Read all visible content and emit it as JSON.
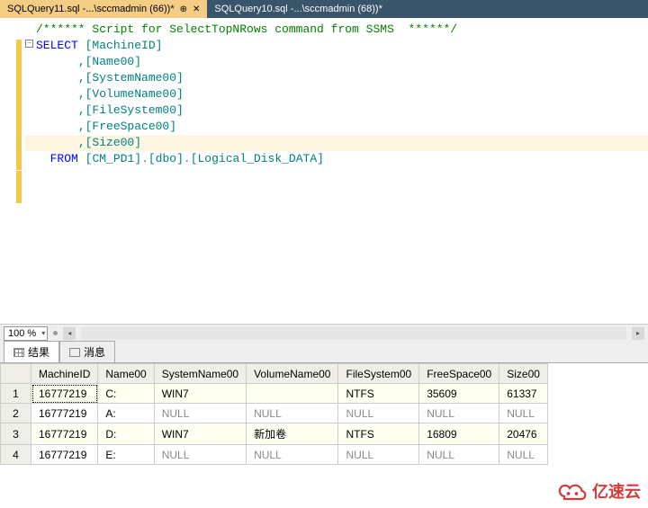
{
  "tabs": {
    "active": {
      "label": "SQLQuery11.sql -...\\sccmadmin (66))*"
    },
    "inactive": {
      "label": "SQLQuery10.sql -...\\sccmadmin (68))*"
    }
  },
  "editor": {
    "comment": "/****** Script for SelectTopNRows command from SSMS  ******/",
    "kw_select": "SELECT",
    "col0": "[MachineID]",
    "col1": ",[Name00]",
    "col2": ",[SystemName00]",
    "col3": ",[VolumeName00]",
    "col4": ",[FileSystem00]",
    "col5": ",[FreeSpace00]",
    "col6": ",[Size00]",
    "kw_from": "FROM",
    "db": "[CM_PD1]",
    "dot1": ".",
    "schema": "[dbo]",
    "dot2": ".",
    "table": "[Logical_Disk_DATA]"
  },
  "zoom": {
    "value": "100 %"
  },
  "resultTabs": {
    "results": "结果",
    "messages": "消息"
  },
  "grid": {
    "headers": [
      "MachineID",
      "Name00",
      "SystemName00",
      "VolumeName00",
      "FileSystem00",
      "FreeSpace00",
      "Size00"
    ],
    "rows": [
      {
        "n": "1",
        "cells": [
          "16777219",
          "C:",
          "WIN7",
          "",
          "NTFS",
          "35609",
          "61337"
        ]
      },
      {
        "n": "2",
        "cells": [
          "16777219",
          "A:",
          "NULL",
          "NULL",
          "NULL",
          "NULL",
          "NULL"
        ]
      },
      {
        "n": "3",
        "cells": [
          "16777219",
          "D:",
          "WIN7",
          "新加卷",
          "NTFS",
          "16809",
          "20476"
        ]
      },
      {
        "n": "4",
        "cells": [
          "16777219",
          "E:",
          "NULL",
          "NULL",
          "NULL",
          "NULL",
          "NULL"
        ]
      }
    ]
  },
  "watermark": {
    "text": "亿速云"
  }
}
